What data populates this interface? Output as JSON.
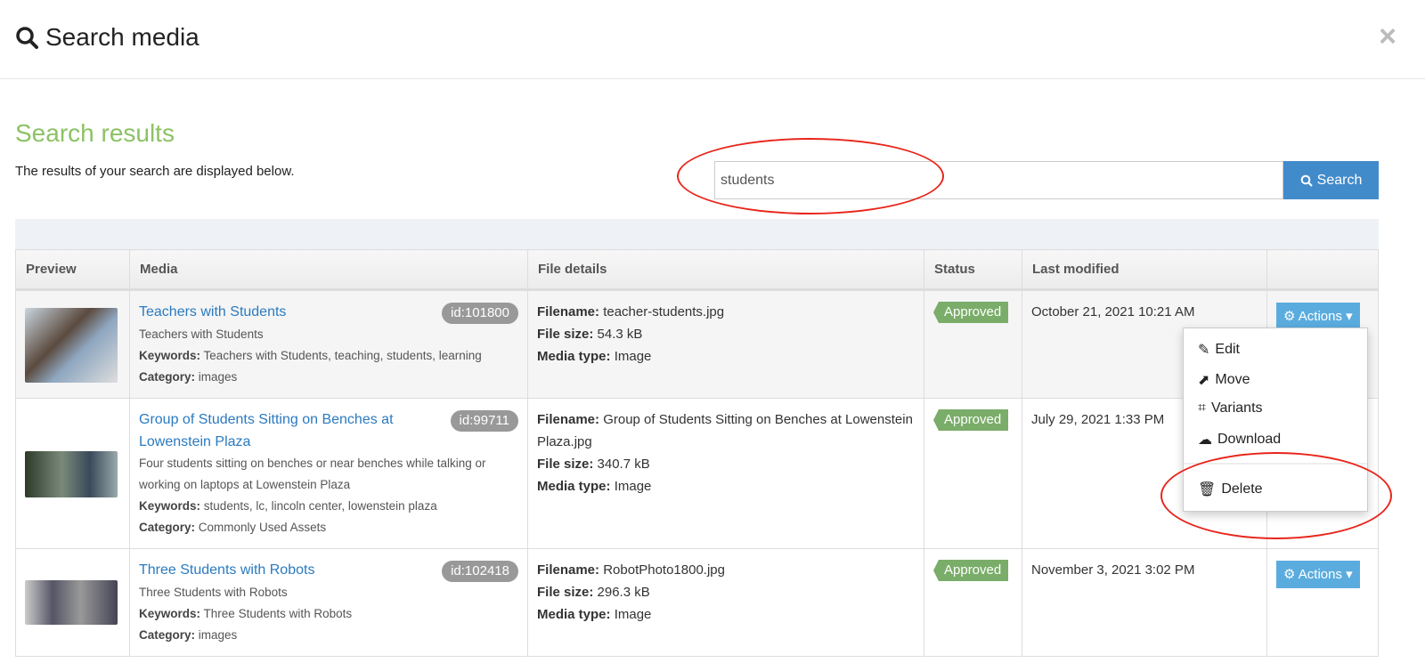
{
  "header": {
    "title": "Search media",
    "close": "×"
  },
  "page": {
    "heading": "Search results",
    "description": "The results of your search are displayed below."
  },
  "search": {
    "value": "students",
    "button": "Search"
  },
  "table": {
    "columns": [
      "Preview",
      "Media",
      "File details",
      "Status",
      "Last modified",
      ""
    ],
    "labels": {
      "filename": "Filename:",
      "filesize": "File size:",
      "mediatype": "Media type:",
      "keywords": "Keywords:",
      "category": "Category:"
    },
    "rows": [
      {
        "title": "Teachers with Students",
        "id": "id:101800",
        "description": "Teachers with Students",
        "keywords": "Teachers with Students, teaching, students, learning",
        "category": "images",
        "filename": "teacher-students.jpg",
        "filesize": "54.3 kB",
        "mediatype": "Image",
        "status": "Approved",
        "modified": "October 21, 2021 10:21 AM",
        "actions": "Actions"
      },
      {
        "title": "Group of Students Sitting on Benches at Lowenstein Plaza",
        "id": "id:99711",
        "description": "Four students sitting on benches or near benches while talking or working on laptops at Lowenstein Plaza",
        "keywords": "students, lc, lincoln center, lowenstein plaza",
        "category": "Commonly Used Assets",
        "filename": "Group of Students Sitting on Benches at Lowenstein Plaza.jpg",
        "filesize": "340.7 kB",
        "mediatype": "Image",
        "status": "Approved",
        "modified": "July 29, 2021 1:33 PM"
      },
      {
        "title": "Three Students with Robots",
        "id": "id:102418",
        "description": "Three Students with Robots",
        "keywords": "Three Students with Robots",
        "category": "images",
        "filename": "RobotPhoto1800.jpg",
        "filesize": "296.3 kB",
        "mediatype": "Image",
        "status": "Approved",
        "modified": "November 3, 2021 3:02 PM",
        "actions": "Actions"
      }
    ]
  },
  "menu": {
    "items": [
      "Edit",
      "Move",
      "Variants",
      "Download",
      "Delete"
    ]
  },
  "colors": {
    "accent": "#428bca",
    "approved": "#7aad69",
    "heading": "#8cc265",
    "annotation": "#e8251b"
  }
}
